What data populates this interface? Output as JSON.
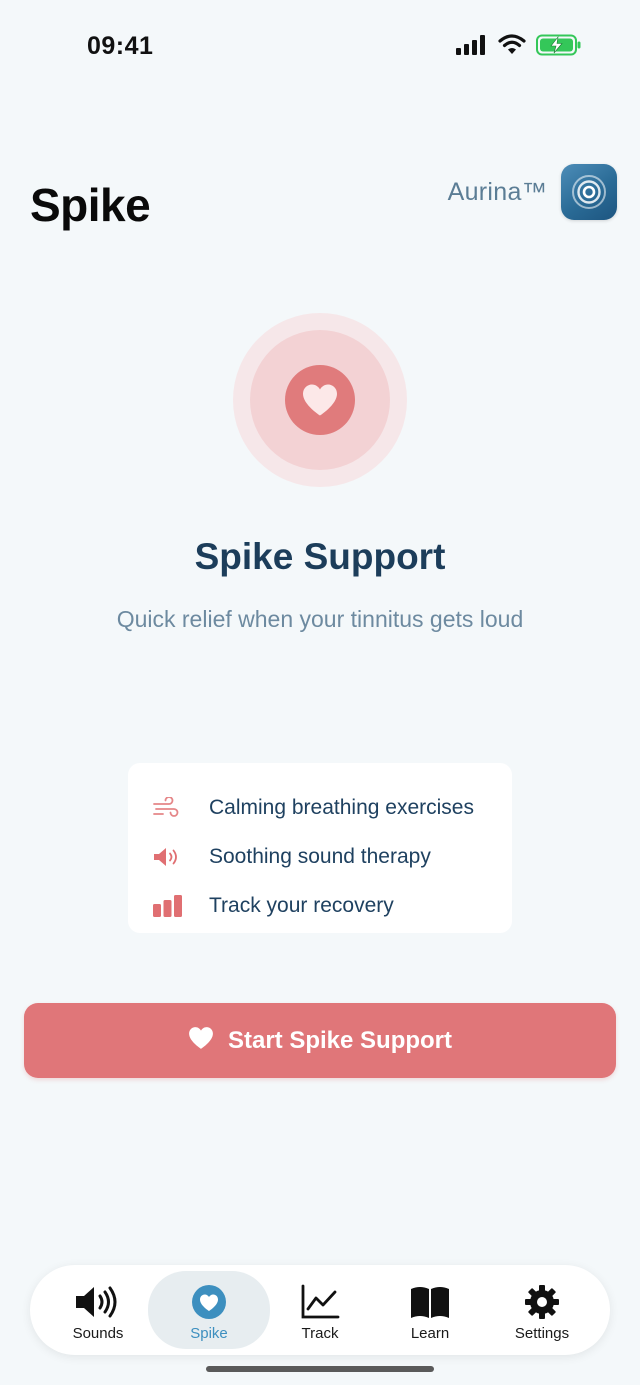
{
  "status_bar": {
    "time": "09:41"
  },
  "header": {
    "title": "Spike",
    "brand_name": "Aurina™",
    "brand_logo_icon": "concentric-rings-icon"
  },
  "hero": {
    "icon": "heart-icon",
    "title": "Spike Support",
    "subtitle": "Quick relief when your tinnitus gets loud"
  },
  "features": [
    {
      "icon": "wind-icon",
      "label": "Calming breathing exercises"
    },
    {
      "icon": "speaker-icon",
      "label": "Soothing sound therapy"
    },
    {
      "icon": "bar-chart-icon",
      "label": "Track your recovery"
    }
  ],
  "cta": {
    "icon": "heart-icon",
    "label": "Start Spike Support"
  },
  "tab_bar": {
    "tabs": [
      {
        "label": "Sounds",
        "icon": "speaker-icon",
        "active": false
      },
      {
        "label": "Spike",
        "icon": "heart-circle-icon",
        "active": true
      },
      {
        "label": "Track",
        "icon": "line-chart-icon",
        "active": false
      },
      {
        "label": "Learn",
        "icon": "book-icon",
        "active": false
      },
      {
        "label": "Settings",
        "icon": "gear-icon",
        "active": false
      }
    ]
  },
  "colors": {
    "background": "#f4f8fa",
    "accent": "#e07679",
    "title": "#1c3d5a",
    "subtitle": "#6d8aa0",
    "active_tab": "#3d8fbf"
  }
}
